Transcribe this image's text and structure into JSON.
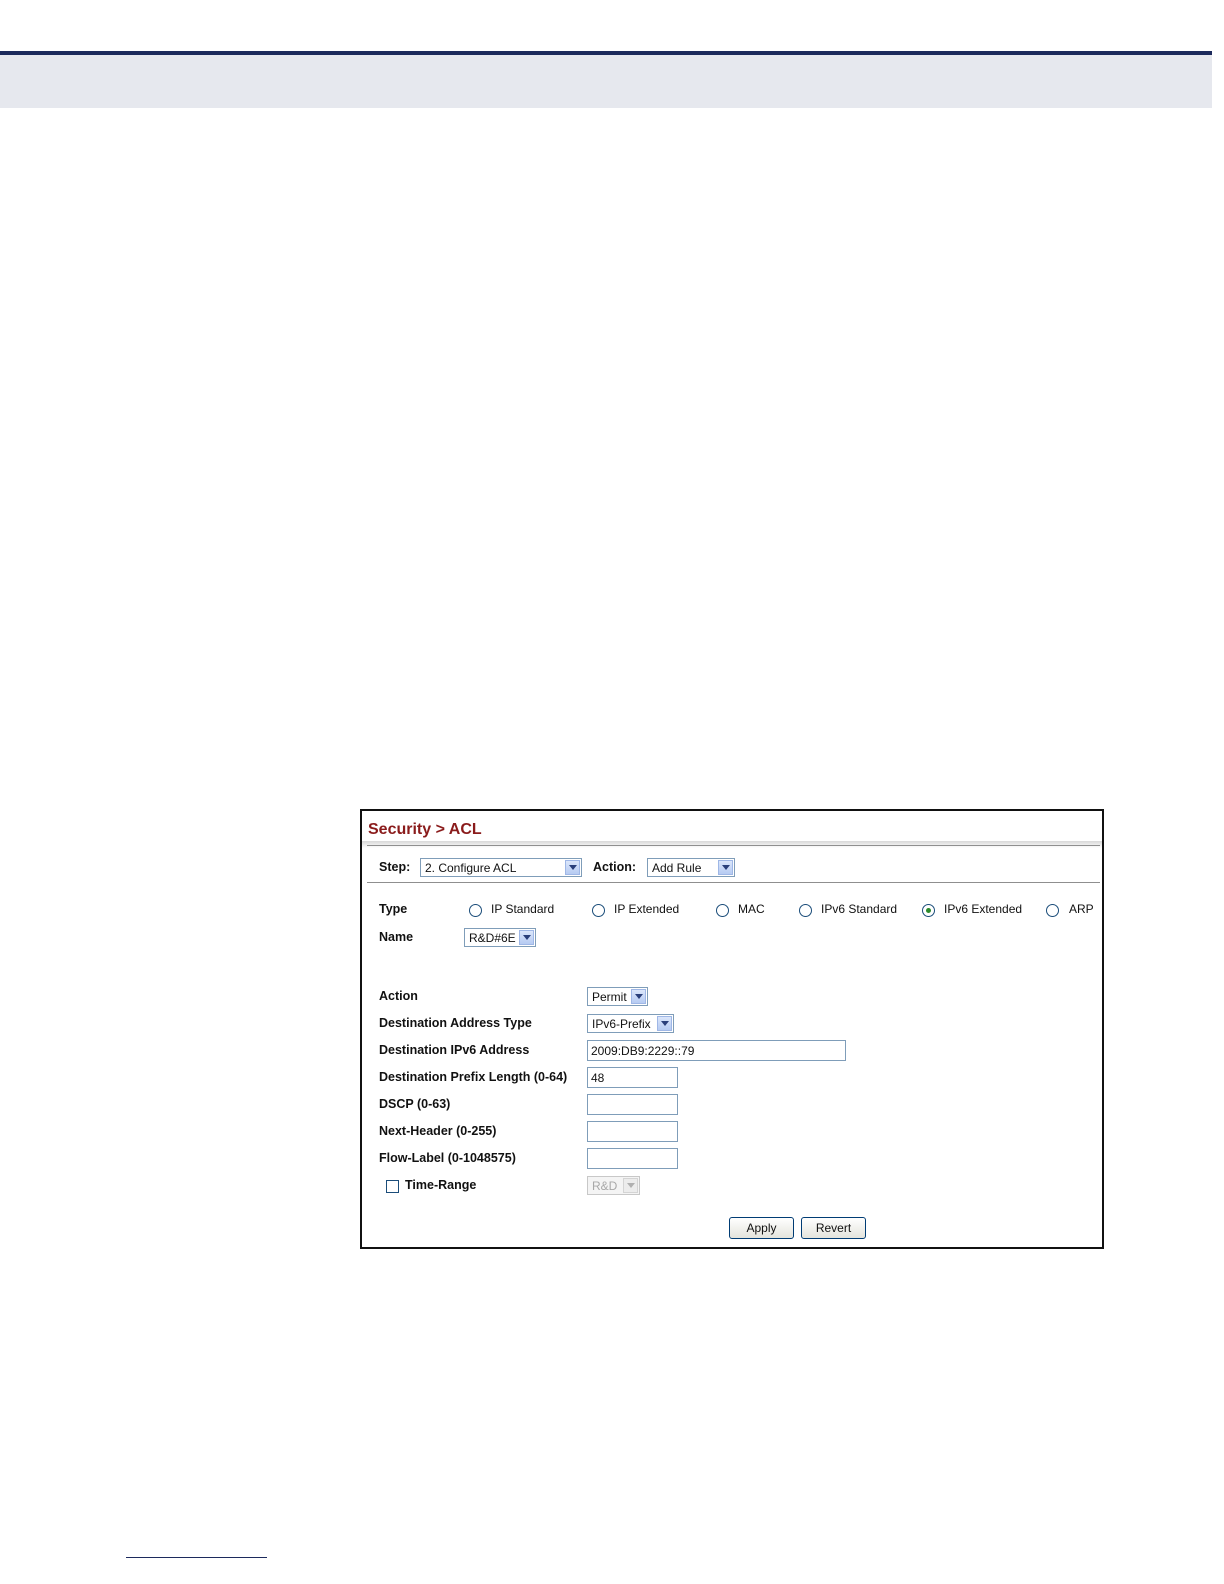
{
  "breadcrumb": {
    "section": "Security",
    "separator": ">",
    "page": "ACL"
  },
  "toolbar": {
    "step_label": "Step:",
    "step_value": "2. Configure ACL",
    "action_label": "Action:",
    "action_value": "Add Rule"
  },
  "type": {
    "label": "Type",
    "options": [
      "IP Standard",
      "IP Extended",
      "MAC",
      "IPv6 Standard",
      "IPv6 Extended",
      "ARP"
    ],
    "selected": "IPv6 Extended"
  },
  "name": {
    "label": "Name",
    "value": "R&D#6E"
  },
  "form": {
    "action_label": "Action",
    "action_value": "Permit",
    "dest_addr_type_label": "Destination Address Type",
    "dest_addr_type_value": "IPv6-Prefix",
    "dest_ipv6_label": "Destination IPv6 Address",
    "dest_ipv6_value": "2009:DB9:2229::79",
    "dest_prefix_label": "Destination Prefix Length (0-64)",
    "dest_prefix_value": "48",
    "dscp_label": "DSCP (0-63)",
    "dscp_value": "",
    "next_header_label": "Next-Header (0-255)",
    "next_header_value": "",
    "flow_label_label": "Flow-Label (0-1048575)",
    "flow_label_value": "",
    "time_range_label": "Time-Range",
    "time_range_value": "R&D"
  },
  "buttons": {
    "apply": "Apply",
    "revert": "Revert"
  },
  "colors": {
    "title": "#8a1b1b",
    "header_rule": "#1c2a5c",
    "header_band": "#e6e8ee"
  }
}
